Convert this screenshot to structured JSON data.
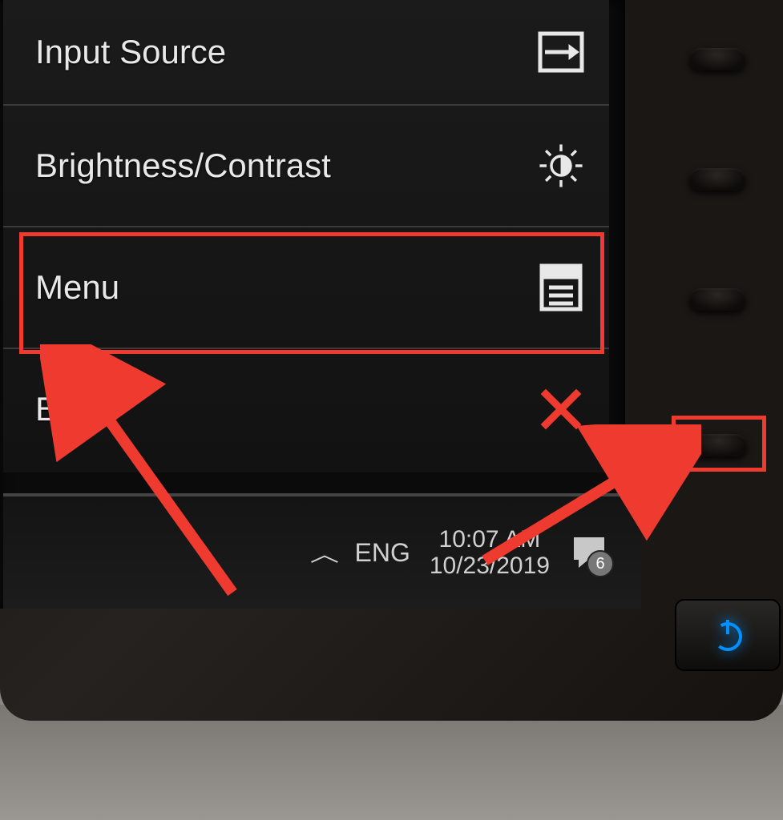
{
  "osd": {
    "items": [
      {
        "label": "Input Source",
        "icon": "input-source-icon"
      },
      {
        "label": "Brightness/Contrast",
        "icon": "brightness-icon"
      },
      {
        "label": "Menu",
        "icon": "menu-icon"
      },
      {
        "label": "Exit",
        "icon": "close-icon"
      }
    ]
  },
  "taskbar": {
    "language": "ENG",
    "time": "10:07 AM",
    "date": "10/23/2019",
    "notification_count": "6"
  },
  "annotation": {
    "highlight_item": "Menu",
    "highlight_button": "physical-button-4"
  }
}
